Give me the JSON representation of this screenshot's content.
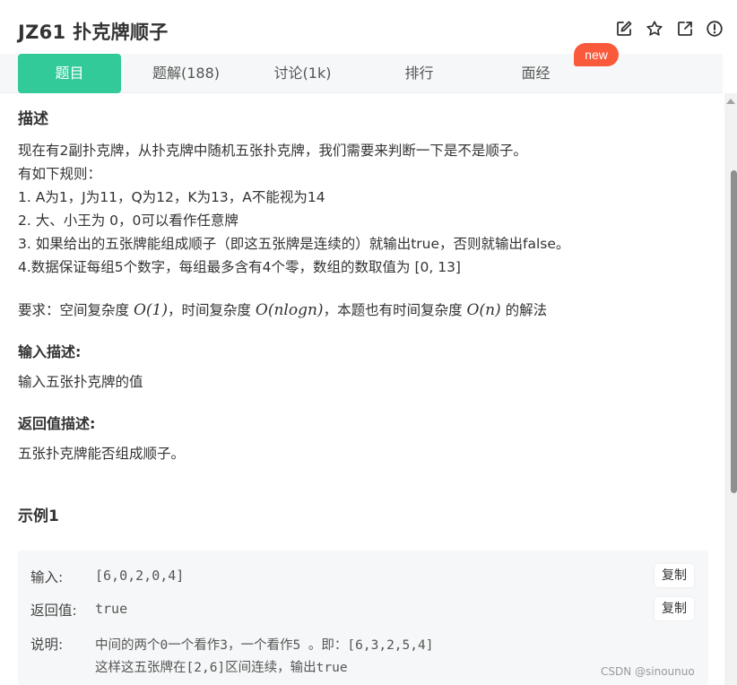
{
  "header": {
    "title": "JZ61  扑克牌顺子",
    "icons": [
      "edit-icon",
      "star-icon",
      "external-link-icon",
      "info-icon"
    ]
  },
  "tabs": [
    {
      "label": "题目",
      "active": true
    },
    {
      "label": "题解(188)",
      "active": false
    },
    {
      "label": "讨论(1k)",
      "active": false
    },
    {
      "label": "排行",
      "active": false
    },
    {
      "label": "面经",
      "active": false
    }
  ],
  "new_badge": "new",
  "colors": {
    "accent": "#32ca99",
    "badge": "#fa5a3c"
  },
  "description": {
    "title": "描述",
    "lines": [
      "现在有2副扑克牌，从扑克牌中随机五张扑克牌，我们需要来判断一下是不是顺子。",
      "有如下规则：",
      "1. A为1，J为11，Q为12，K为13，A不能视为14",
      "2. 大、小王为 0，0可以看作任意牌",
      "3. 如果给出的五张牌能组成顺子（即这五张牌是连续的）就输出true，否则就输出false。",
      "4.数据保证每组5个数字，每组最多含有4个零，数组的数取值为 [0, 13]"
    ],
    "requirement": {
      "prefix": "要求：空间复杂度 ",
      "space": "O(1)",
      "mid": "，时间复杂度 ",
      "time": "O(nlogn)",
      "mid2": "，本题也有时间复杂度 ",
      "alt": "O(n)",
      "suffix": " 的解法"
    }
  },
  "input_desc": {
    "title": "输入描述:",
    "text": "输入五张扑克牌的值"
  },
  "return_desc": {
    "title": "返回值描述:",
    "text": "五张扑克牌能否组成顺子。"
  },
  "example": {
    "title": "示例1",
    "input_label": "输入:",
    "input_value": "[6,0,2,0,4]",
    "return_label": "返回值:",
    "return_value": "true",
    "explain_label": "说明:",
    "explain_line1": "中间的两个0一个看作3，一个看作5 。即：[6,3,2,5,4]",
    "explain_line2": "这样这五张牌在[2,6]区间连续，输出true",
    "copy_label": "复制"
  },
  "watermark": "CSDN @sinounuo"
}
